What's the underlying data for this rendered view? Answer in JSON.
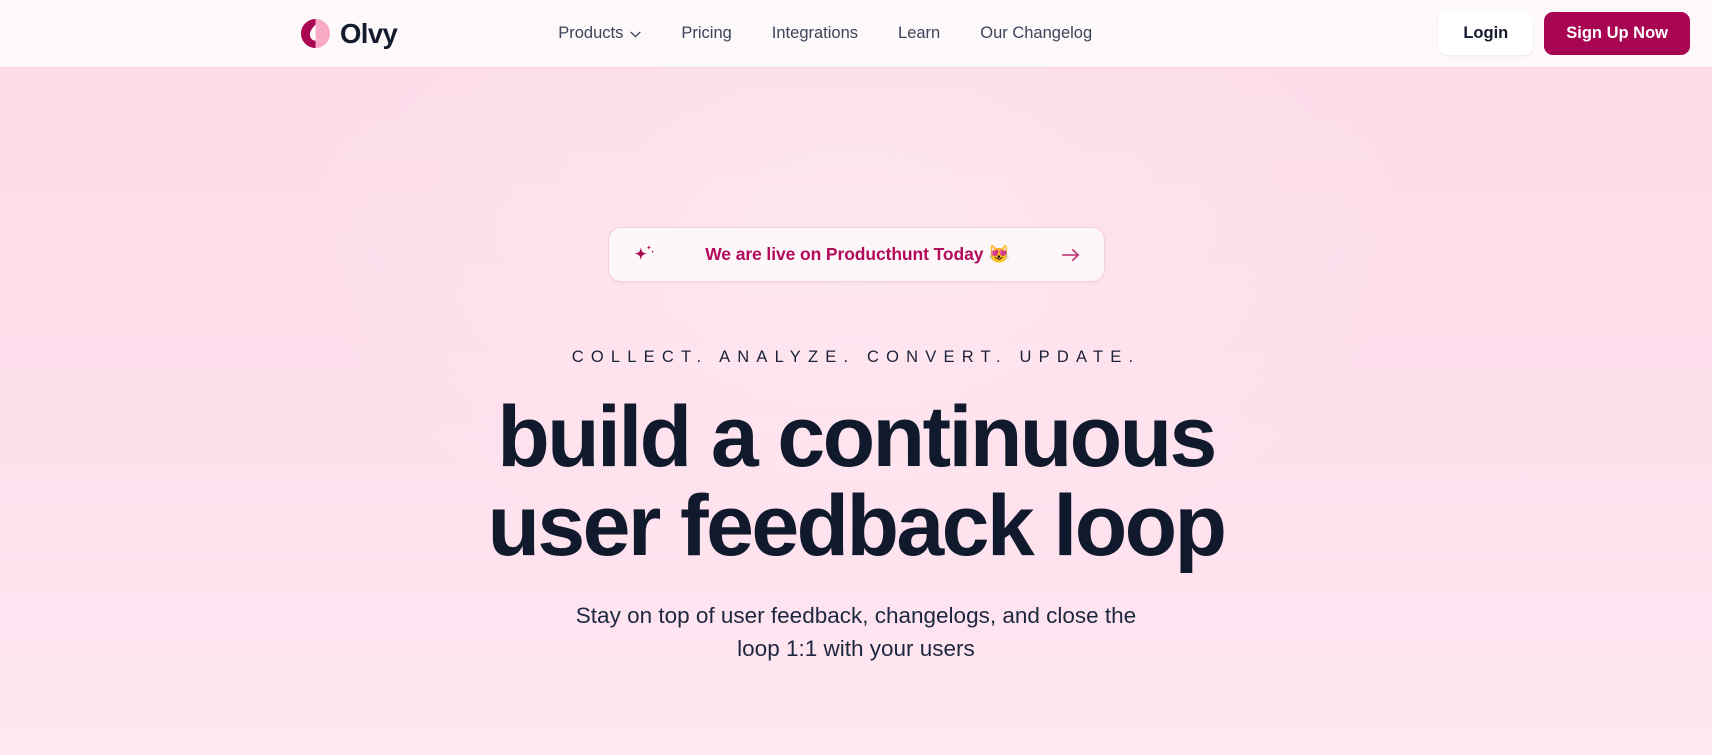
{
  "header": {
    "brand": {
      "logo_icon": "olvy-droplet-circle-logo",
      "name": "Olvy",
      "color_dark": "#a80552",
      "color_light": "#f9a8c5"
    },
    "nav": [
      {
        "label": "Products",
        "has_dropdown": true,
        "icon": "chevron-down-icon"
      },
      {
        "label": "Pricing",
        "has_dropdown": false
      },
      {
        "label": "Integrations",
        "has_dropdown": false
      },
      {
        "label": "Learn",
        "has_dropdown": false
      },
      {
        "label": "Our Changelog",
        "has_dropdown": false
      }
    ],
    "login_label": "Login",
    "signup_label": "Sign Up Now",
    "signup_bg": "#a80552"
  },
  "hero": {
    "announcement": {
      "leading_icon": "sparkle-icon",
      "text": "We are live on Producthunt Today 😻",
      "trailing_icon": "arrow-right-icon",
      "text_color": "#b30a5c"
    },
    "eyebrow": "COLLECT. ANALYZE. CONVERT. UPDATE.",
    "headline_line1": "build a continuous",
    "headline_line2": "user feedback loop",
    "headline_color": "#111a2c",
    "subtext_line1": "Stay on top of user feedback, changelogs, and close the",
    "subtext_line2": "loop 1:1 with your users",
    "background_top": "#fcdbe8",
    "background_bottom": "#ffe8f2"
  }
}
